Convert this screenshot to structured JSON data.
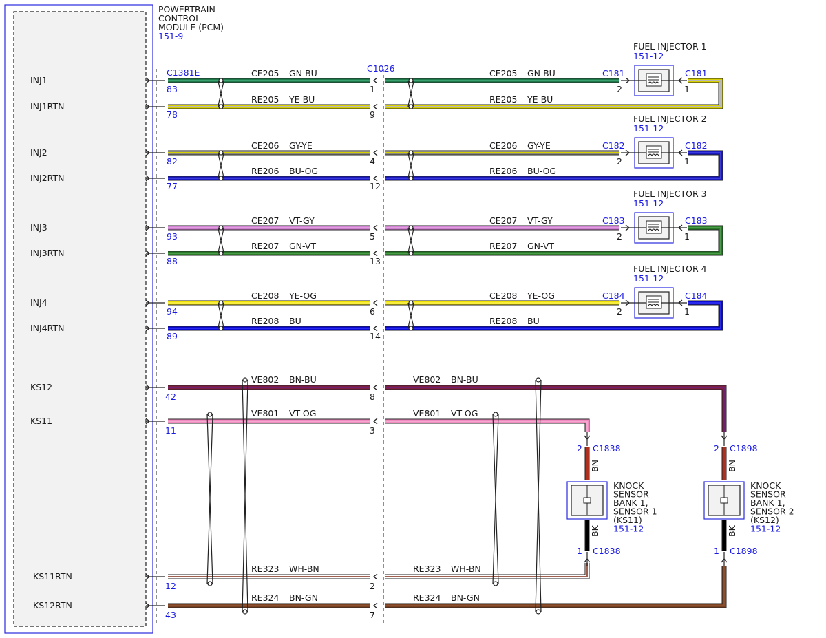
{
  "module": {
    "title_lines": [
      "POWERTRAIN",
      "CONTROL",
      "MODULE (PCM)"
    ],
    "ref": "151-9",
    "connector": "C1381E"
  },
  "inline_connector": "C1026",
  "colors": {
    "GN-BU": [
      "#1f7a4a",
      "#3aa070"
    ],
    "YE-BU": [
      "#d8d000",
      "#b8b8b8"
    ],
    "GY-YE": [
      "#8a8a7a",
      "#d8d000"
    ],
    "BU-OG": [
      "#1a1abf",
      "#3b3bdb"
    ],
    "VT-GY": [
      "#d080d0",
      "#e0a0e0"
    ],
    "GN-VT": [
      "#2a7a2a",
      "#4a9a4a"
    ],
    "YE-OG": [
      "#f0e000",
      "#f7ee40"
    ],
    "BU": [
      "#0a0ad0",
      "#2a2aee"
    ],
    "BN-BU": [
      "#802040",
      "#702070"
    ],
    "VT-OG": [
      "#f08cc0",
      "#f4a8d0"
    ],
    "WH-BN": [
      "#ffffff",
      "#a06050"
    ],
    "BN-GN": [
      "#7a4020",
      "#8a5030"
    ],
    "BN": [
      "#b03020",
      "#b03020"
    ],
    "BK": [
      "#000000",
      "#000000"
    ],
    "text_blue": "#1a1ae6"
  },
  "injectors": [
    {
      "name": "FUEL INJECTOR 1",
      "ref": "151-12",
      "conn": "C181",
      "pin_in": "2",
      "pin_out": "1",
      "return_color": "YE-BU",
      "signal": {
        "label": "INJ1",
        "pcm_pin": "83",
        "inline_pin": "1",
        "circuit": "CE205",
        "color": "GN-BU"
      },
      "return": {
        "label": "INJ1RTN",
        "pcm_pin": "78",
        "inline_pin": "9",
        "circuit": "RE205",
        "color": "YE-BU"
      }
    },
    {
      "name": "FUEL INJECTOR 2",
      "ref": "151-12",
      "conn": "C182",
      "pin_in": "2",
      "pin_out": "1",
      "return_color": "BU-OG",
      "signal": {
        "label": "INJ2",
        "pcm_pin": "82",
        "inline_pin": "4",
        "circuit": "CE206",
        "color": "GY-YE"
      },
      "return": {
        "label": "INJ2RTN",
        "pcm_pin": "77",
        "inline_pin": "12",
        "circuit": "RE206",
        "color": "BU-OG"
      }
    },
    {
      "name": "FUEL INJECTOR 3",
      "ref": "151-12",
      "conn": "C183",
      "pin_in": "2",
      "pin_out": "1",
      "return_color": "GN-VT",
      "signal": {
        "label": "INJ3",
        "pcm_pin": "93",
        "inline_pin": "5",
        "circuit": "CE207",
        "color": "VT-GY"
      },
      "return": {
        "label": "INJ3RTN",
        "pcm_pin": "88",
        "inline_pin": "13",
        "circuit": "RE207",
        "color": "GN-VT"
      }
    },
    {
      "name": "FUEL INJECTOR 4",
      "ref": "151-12",
      "conn": "C184",
      "pin_in": "2",
      "pin_out": "1",
      "return_color": "BU",
      "signal": {
        "label": "INJ4",
        "pcm_pin": "94",
        "inline_pin": "6",
        "circuit": "CE208",
        "color": "YE-OG"
      },
      "return": {
        "label": "INJ4RTN",
        "pcm_pin": "89",
        "inline_pin": "14",
        "circuit": "RE208",
        "color": "BU"
      }
    }
  ],
  "knock": {
    "ks12": {
      "label": "KS12",
      "pcm_pin": "42",
      "inline_pin": "8",
      "circuit": "VE802",
      "color": "BN-BU"
    },
    "ks11": {
      "label": "KS11",
      "pcm_pin": "11",
      "inline_pin": "3",
      "circuit": "VE801",
      "color": "VT-OG"
    },
    "ks11rtn": {
      "label": "KS11RTN",
      "pcm_pin": "12",
      "inline_pin": "2",
      "circuit": "RE323",
      "color": "WH-BN"
    },
    "ks12rtn": {
      "label": "KS12RTN",
      "pcm_pin": "43",
      "inline_pin": "7",
      "circuit": "RE324",
      "color": "BN-GN"
    },
    "sensors": [
      {
        "name_lines": [
          "KNOCK",
          "SENSOR",
          "BANK 1,",
          "SENSOR 1",
          "(KS11)"
        ],
        "ref": "151-12",
        "conn": "C1838",
        "pin_top": "2",
        "pin_bot": "1",
        "top_wire": "BN",
        "bot_wire": "BK"
      },
      {
        "name_lines": [
          "KNOCK",
          "SENSOR",
          "BANK 1,",
          "SENSOR 2",
          "(KS12)"
        ],
        "ref": "151-12",
        "conn": "C1898",
        "pin_top": "2",
        "pin_bot": "1",
        "top_wire": "BN",
        "bot_wire": "BK"
      }
    ]
  }
}
